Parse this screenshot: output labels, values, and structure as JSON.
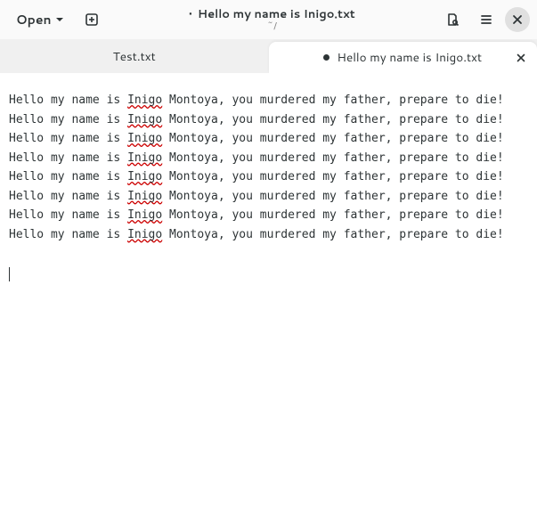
{
  "header": {
    "open_label": "Open",
    "title_modified_marker": "•",
    "title": "Hello my name is Inigo.txt",
    "subtitle": "~/"
  },
  "tabs": [
    {
      "label": "Test.txt",
      "modified": false,
      "active": false
    },
    {
      "label": "Hello my name is Inigo.txt",
      "modified": true,
      "active": true
    }
  ],
  "editor": {
    "misspelled_word": "Inigo",
    "line_prefix": "Hello my name is ",
    "line_suffix": " Montoya, you murdered my father, prepare to die!",
    "line_count": 8
  },
  "icons": {
    "new_tab": "new-tab-icon",
    "sidebar_toggle": "document-panel-icon",
    "menu": "hamburger-icon",
    "close": "close-icon",
    "chevron_down": "chevron-down-icon"
  }
}
